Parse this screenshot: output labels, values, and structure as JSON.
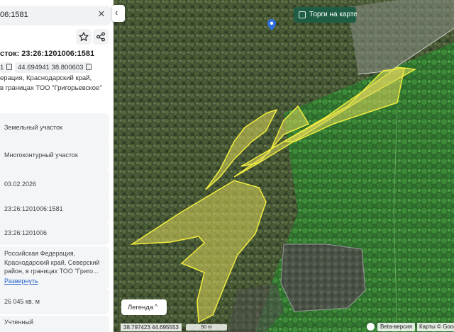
{
  "search": {
    "value": "06:1581"
  },
  "panel": {
    "parcel_title": "сток: 23:26:1201006:1581",
    "chips": {
      "cadastral_tail": "1",
      "coords": "44.694941 38.800603"
    },
    "address_lines": [
      "ерация, Краснодарский край,",
      "в границах ТОО \"Григорьевское\""
    ],
    "fields": [
      {
        "value": "Земельный участок"
      },
      {
        "value": "Многоконтурный участок"
      },
      {
        "value": "03.02.2026"
      },
      {
        "value": "23:26:1201006:1581"
      },
      {
        "value": "23:26:1201006"
      },
      {
        "lines": [
          "Российская Федерация,",
          "Краснодарский край, Северский",
          "район, в границах ТОО \"Григо..."
        ]
      },
      {
        "value": "26 045 кв. м"
      },
      {
        "value": "Учтенный"
      }
    ],
    "expand_link": "Развернуть"
  },
  "map": {
    "torgi_label": "Торги на карте",
    "legend_label": "Легенда",
    "coords_readout": "38.797423  44.695553",
    "scale_label": "50 m",
    "beta_label": "Beta-версия",
    "copyright": "Карты © Google"
  },
  "colors": {
    "parcel_fill": "#d9d45a",
    "parcel_stroke": "#f2ee3c",
    "accent_green": "#1f5e45",
    "link": "#2563c9"
  }
}
